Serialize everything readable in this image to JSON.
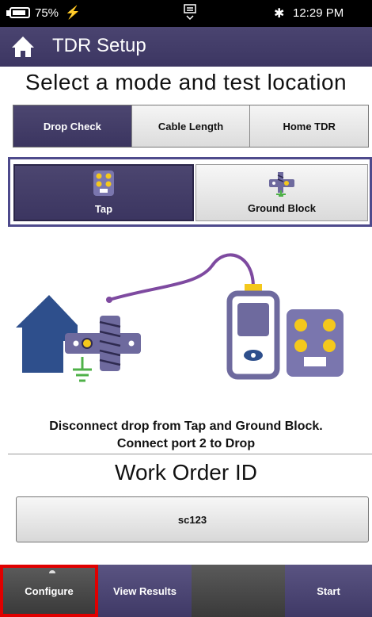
{
  "status": {
    "battery": "75%",
    "time": "12:29 PM"
  },
  "header": {
    "title": "TDR Setup"
  },
  "heading": "Select a mode and test location",
  "modes": [
    {
      "label": "Drop Check",
      "selected": true
    },
    {
      "label": "Cable Length",
      "selected": false
    },
    {
      "label": "Home TDR",
      "selected": false
    }
  ],
  "locations": [
    {
      "label": "Tap",
      "selected": true
    },
    {
      "label": "Ground Block",
      "selected": false
    }
  ],
  "instruction": {
    "line1": "Disconnect drop from Tap and Ground Block.",
    "line2": "Connect port 2 to Drop"
  },
  "work_order": {
    "label": "Work Order ID",
    "value": "sc123"
  },
  "toolbar": {
    "configure": "Configure",
    "view_results": "View Results",
    "start": "Start"
  },
  "colors": {
    "accent": "#3c3662",
    "illustration": "#6e6a9e",
    "house": "#2e4f8c",
    "cable": "#7e4aa0",
    "port": "#f4c81c",
    "ground": "#4fb148",
    "highlight": "#e00000"
  }
}
